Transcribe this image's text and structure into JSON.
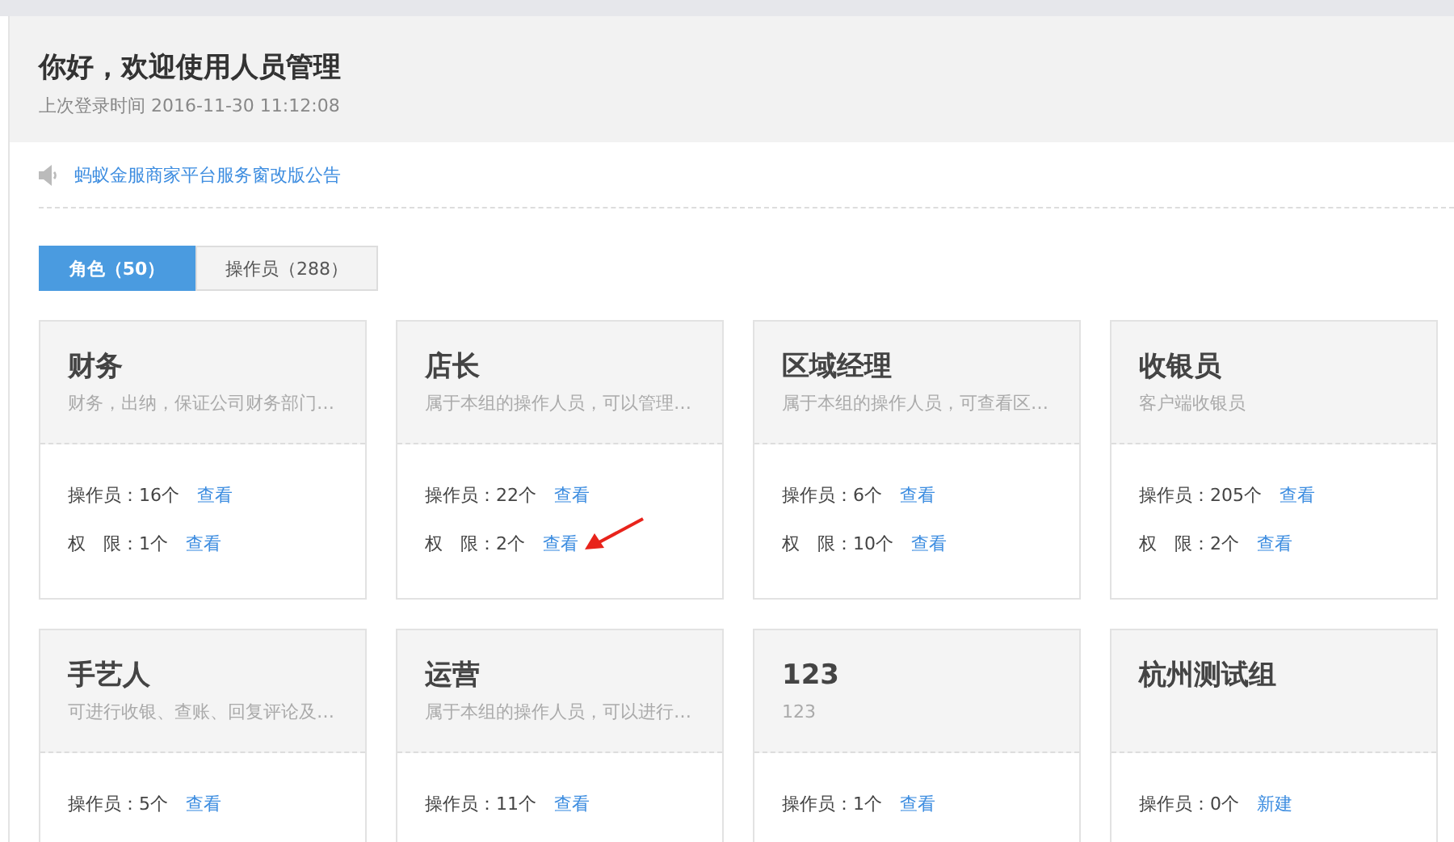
{
  "header": {
    "title": "你好，欢迎使用人员管理",
    "last_login": "上次登录时间 2016-11-30 11:12:08"
  },
  "notice": {
    "text": "蚂蚁金服商家平台服务窗改版公告"
  },
  "tabs": [
    {
      "label": "角色（50）",
      "selected": true
    },
    {
      "label": "操作员（288）",
      "selected": false
    }
  ],
  "roles": [
    {
      "name": "财务",
      "description": "财务，出纳，保证公司财务部门…",
      "stats": [
        {
          "label": "操作员：16个",
          "link": "查看"
        },
        {
          "label": "权　限：1个",
          "link": "查看"
        }
      ]
    },
    {
      "name": "店长",
      "description": "属于本组的操作人员，可以管理…",
      "stats": [
        {
          "label": "操作员：22个",
          "link": "查看"
        },
        {
          "label": "权　限：2个",
          "link": "查看"
        }
      ]
    },
    {
      "name": "区域经理",
      "description": "属于本组的操作人员，可查看区…",
      "stats": [
        {
          "label": "操作员：6个",
          "link": "查看"
        },
        {
          "label": "权　限：10个",
          "link": "查看"
        }
      ]
    },
    {
      "name": "收银员",
      "description": "客户端收银员",
      "stats": [
        {
          "label": "操作员：205个",
          "link": "查看"
        },
        {
          "label": "权　限：2个",
          "link": "查看"
        }
      ]
    },
    {
      "name": "手艺人",
      "description": "可进行收银、查账、回复评论及…",
      "stats": [
        {
          "label": "操作员：5个",
          "link": "查看"
        }
      ]
    },
    {
      "name": "运营",
      "description": "属于本组的操作人员，可以进行…",
      "stats": [
        {
          "label": "操作员：11个",
          "link": "查看"
        }
      ]
    },
    {
      "name": "123",
      "description": "123",
      "stats": [
        {
          "label": "操作员：1个",
          "link": "查看"
        }
      ]
    },
    {
      "name": "杭州测试组",
      "stats": [
        {
          "label": "操作员：0个",
          "link": "新建"
        }
      ]
    }
  ]
}
